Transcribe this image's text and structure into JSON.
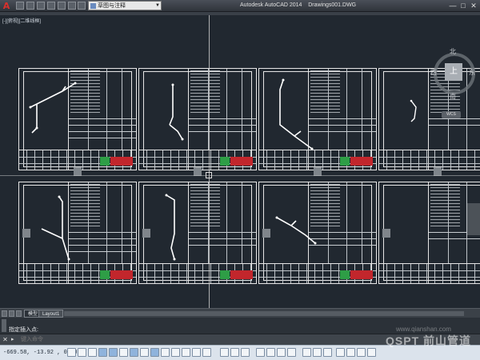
{
  "titlebar": {
    "app_logo": "A",
    "workspace": "草图与注释",
    "title": "Autodesk AutoCAD 2014    Drawings001.DWG",
    "window_controls": [
      "—",
      "□",
      "✕"
    ]
  },
  "canvas": {
    "viewport_label": "[-][俯视][二维线框]",
    "viewcube": {
      "face": "上",
      "north": "北",
      "south": "南",
      "east": "东",
      "west": "西",
      "wcs": "WCS"
    }
  },
  "tabs": {
    "model": "模型",
    "layout": "Layout1"
  },
  "command": {
    "history": "指定插入点:",
    "close_glyph": "✕",
    "placeholder": "键入命令"
  },
  "status": {
    "coords": "-669.58, -13.92 , 0.00"
  },
  "watermark": {
    "text": "QSPT 前山管道",
    "url": "www.qianshan.com"
  },
  "colors": {
    "background": "#212830",
    "statusbar": "#dbe3ec",
    "accent_red": "#c2262c",
    "accent_green": "#2e9e46"
  }
}
